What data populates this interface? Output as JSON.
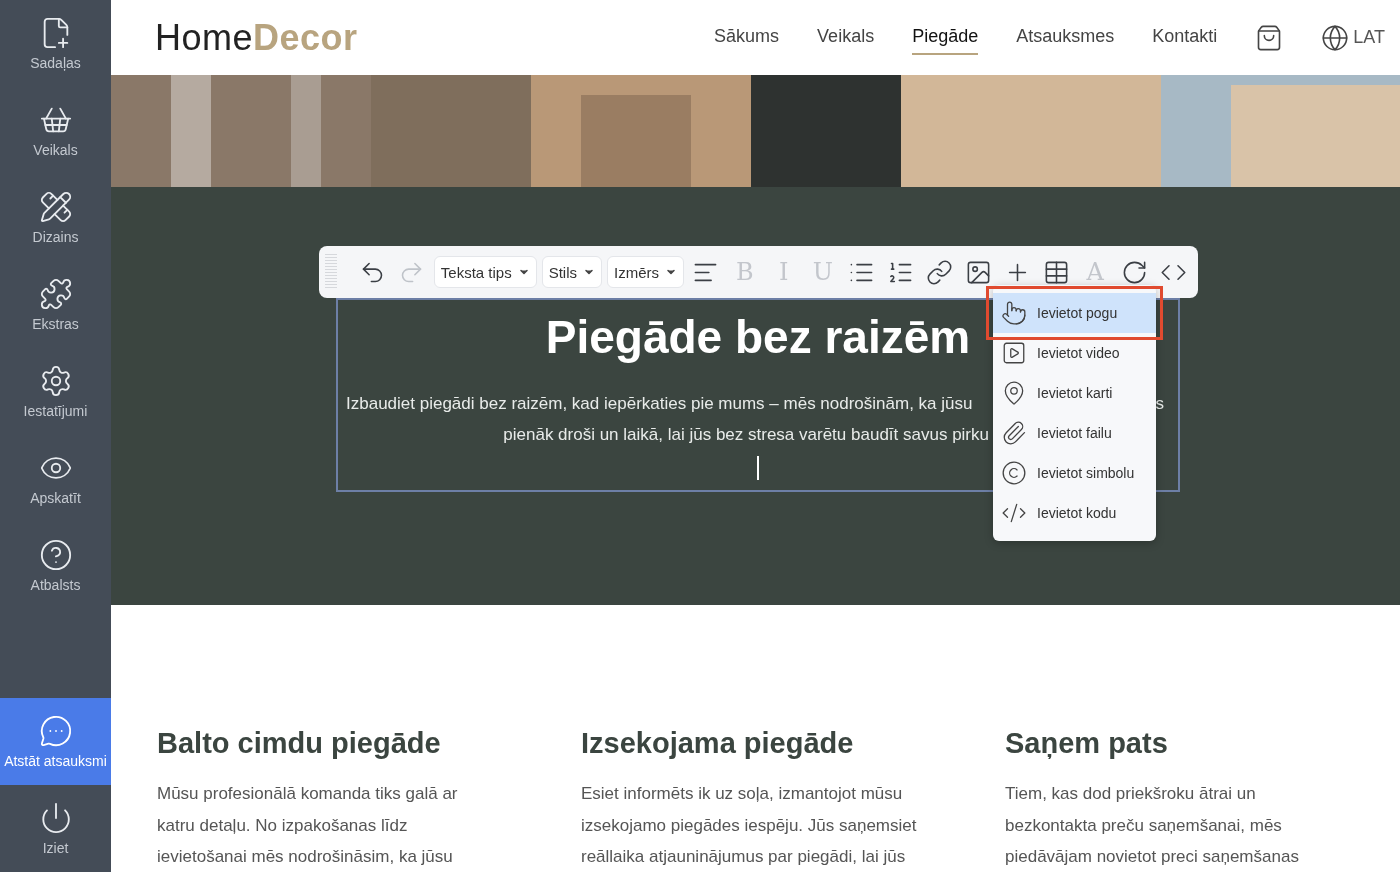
{
  "sidebar": {
    "items": [
      {
        "label": "Sadaļas",
        "selected": false
      },
      {
        "label": "Veikals",
        "selected": false
      },
      {
        "label": "Dizains",
        "selected": false
      },
      {
        "label": "Ekstras",
        "selected": false
      },
      {
        "label": "Iestatījumi",
        "selected": false
      },
      {
        "label": "Apskatīt",
        "selected": false
      },
      {
        "label": "Atbalsts",
        "selected": false
      }
    ],
    "feedback": {
      "label": "Atstāt atsauksmi",
      "selected": true
    },
    "logout": {
      "label": "Iziet",
      "selected": false
    }
  },
  "header": {
    "logo": {
      "light": "Home",
      "bold": "Decor"
    },
    "nav": [
      {
        "label": "Sākums",
        "selected": false
      },
      {
        "label": "Veikals",
        "selected": false
      },
      {
        "label": "Piegāde",
        "selected": true
      },
      {
        "label": "Atsauksmes",
        "selected": false
      },
      {
        "label": "Kontakti",
        "selected": false
      }
    ],
    "language": "LAT"
  },
  "toolbar": {
    "items": [
      {
        "kind": "icon",
        "disabled": false
      },
      {
        "kind": "icon",
        "disabled": true
      },
      {
        "kind": "dropdown",
        "label": "Teksta tips"
      },
      {
        "kind": "dropdown",
        "label": "Stils"
      },
      {
        "kind": "dropdown",
        "label": "Izmērs"
      },
      {
        "kind": "icon",
        "disabled": false
      },
      {
        "kind": "letter",
        "label": "B",
        "disabled": true
      },
      {
        "kind": "letter",
        "label": "I",
        "disabled": true
      },
      {
        "kind": "letter",
        "label": "U",
        "disabled": true
      },
      {
        "kind": "icon",
        "disabled": false
      },
      {
        "kind": "icon",
        "disabled": false
      },
      {
        "kind": "icon",
        "disabled": false
      },
      {
        "kind": "icon",
        "disabled": false
      },
      {
        "kind": "icon",
        "disabled": false
      },
      {
        "kind": "icon",
        "disabled": false
      },
      {
        "kind": "letter",
        "label": "A",
        "disabled": true
      },
      {
        "kind": "icon",
        "disabled": false
      },
      {
        "kind": "icon",
        "disabled": false
      }
    ]
  },
  "editor": {
    "heading": "Piegāde bez raizēm",
    "line_1": "Izbaudiet piegādi bez raizēm, kad iepērkaties pie mums – mēs nodrošinām, ka jūsu",
    "line_1_end": "s",
    "line_2": "pienāk droši un laikā, lai jūs bez stresa varētu baudīt savus pirku"
  },
  "insert_menu": {
    "items": [
      {
        "label": "Ievietot pogu",
        "selected": true,
        "outlined": true
      },
      {
        "label": "Ievietot video",
        "selected": false,
        "outlined": false
      },
      {
        "label": "Ievietot karti",
        "selected": false,
        "outlined": false
      },
      {
        "label": "Ievietot failu",
        "selected": false,
        "outlined": false
      },
      {
        "label": "Ievietot simbolu",
        "selected": false,
        "outlined": false
      },
      {
        "label": "Ievietot kodu",
        "selected": false,
        "outlined": false
      }
    ]
  },
  "features": [
    {
      "title": "Balto cimdu piegāde",
      "lines": [
        "Mūsu profesionālā komanda tiks galā ar",
        "katru detaļu. No izpakošanas līdz",
        "ievietošanai mēs nodrošināsim, ka jūsu"
      ]
    },
    {
      "title": "Izsekojama piegāde",
      "lines": [
        "Esiet informēts ik uz soļa, izmantojot mūsu",
        "izsekojamo piegādes iespēju. Jūs saņemsiet",
        "reāllaika atjauninājumus par piegādi, lai jūs"
      ]
    },
    {
      "title": "Saņem pats",
      "lines": [
        "Tiem, kas dod priekšroku ātrai un",
        "bezkontakta preču saņemšanai, mēs",
        "piedāvājam novietot preci saņemšanas"
      ]
    }
  ]
}
